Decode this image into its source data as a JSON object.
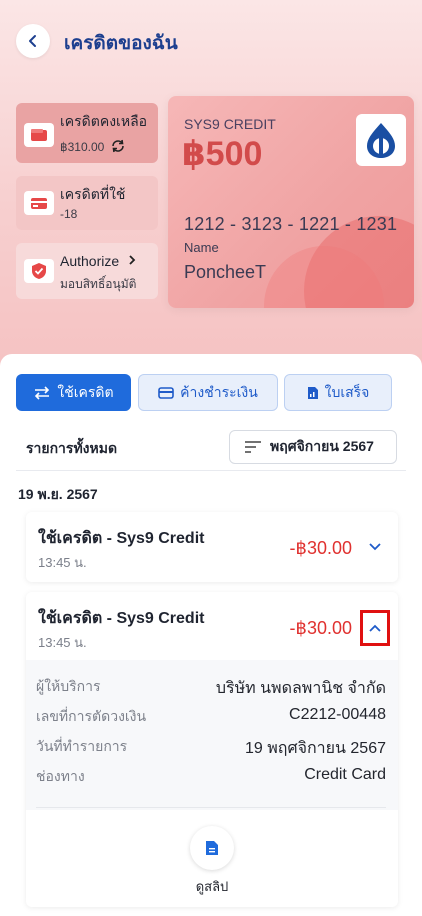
{
  "header": {
    "title": "เครดิตของฉัน"
  },
  "summary": {
    "remaining_label": "เครดิตคงเหลือ",
    "remaining_value": "฿310.00",
    "used_label": "เครดิตที่ใช้",
    "used_value": "-18",
    "authorize_label": "Authorize",
    "authorize_sub": "มอบสิทธิ์อนุมัติ"
  },
  "card": {
    "brand": "SYS9 CREDIT",
    "amount": "฿500",
    "number": "1212 - 3123 - 1221 - 1231",
    "name_label": "Name",
    "name": "PoncheeT"
  },
  "tabs": [
    {
      "label": "ใช้เครดิต",
      "icon": "swap-arrows-icon",
      "active": true
    },
    {
      "label": "ค้างชำระเงิน",
      "icon": "credit-card-icon",
      "active": false
    },
    {
      "label": "ใบเสร็จ",
      "icon": "receipt-icon",
      "active": false
    }
  ],
  "list": {
    "heading": "รายการทั้งหมด",
    "filter_label": "พฤศจิกายน 2567"
  },
  "group_date": "19 พ.ย. 2567",
  "transactions": [
    {
      "title": "ใช้เครดิต - Sys9 Credit",
      "time": "13:45 น.",
      "amount": "-฿30.00"
    },
    {
      "title": "ใช้เครดิต - Sys9 Credit",
      "time": "13:45 น.",
      "amount": "-฿30.00"
    }
  ],
  "details": {
    "provider_label": "ผู้ให้บริการ",
    "provider_value": "บริษัท นพดลพานิช จำกัด",
    "ref_label": "เลขที่การตัดวงเงิน",
    "ref_value": "C2212-00448",
    "date_label": "วันที่ทำรายการ",
    "date_value": "19 พฤศจิกายน 2567",
    "channel_label": "ช่องทาง",
    "channel_value": "Credit Card",
    "slip_label": "ดูสลิป"
  },
  "colors": {
    "primary": "#1f6bdc",
    "negative": "#e0312f",
    "header_bg": "#f7cfcf",
    "title": "#1d3f8f"
  }
}
